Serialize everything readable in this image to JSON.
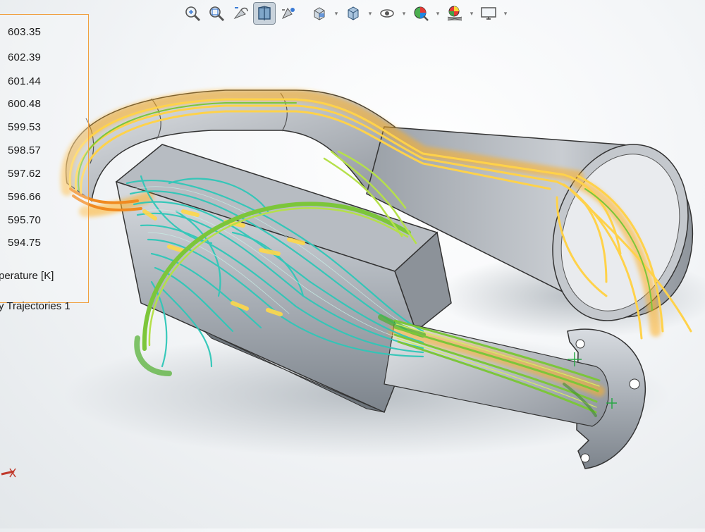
{
  "toolbar": {
    "buttons": [
      {
        "name": "zoom-to-fit-icon"
      },
      {
        "name": "zoom-to-area-icon"
      },
      {
        "name": "previous-view-icon"
      },
      {
        "name": "section-view-icon",
        "active": true
      },
      {
        "name": "dynamic-annotation-icon"
      },
      {
        "name": "view-orientation-icon",
        "dropdown": true
      },
      {
        "name": "display-style-icon",
        "dropdown": true
      },
      {
        "name": "hide-show-items-icon",
        "dropdown": true
      },
      {
        "name": "edit-appearance-icon",
        "dropdown": true
      },
      {
        "name": "apply-scene-icon",
        "dropdown": true
      },
      {
        "name": "view-settings-icon",
        "dropdown": true
      }
    ]
  },
  "legend": {
    "values": [
      "603.35",
      "602.39",
      "601.44",
      "600.48",
      "599.53",
      "598.57",
      "597.62",
      "596.66",
      "595.70",
      "594.75"
    ],
    "parameter_label": "perature [K]",
    "plot_label": "y Trajectories 1",
    "frame_color": "#f0a040"
  },
  "colors": {
    "hot": "#f5a623",
    "warm": "#ffd84a",
    "mid": "#8bc92e",
    "cool": "#2fc7b8",
    "metal": "#9aa0a8"
  }
}
